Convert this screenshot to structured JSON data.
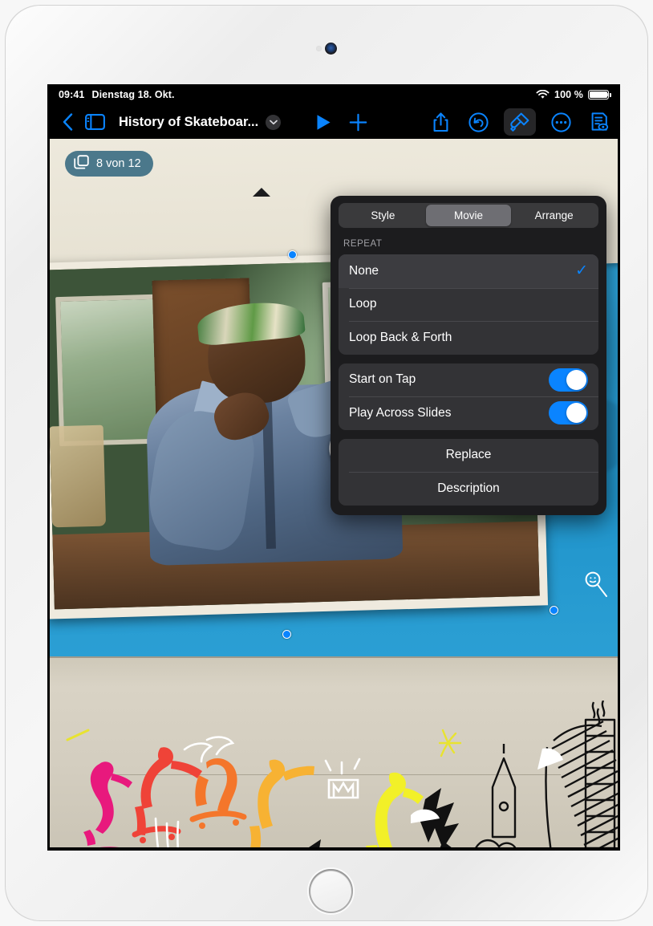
{
  "status_bar": {
    "time": "09:41",
    "date": "Dienstag 18. Okt.",
    "battery_text": "100 %",
    "wifi_icon": "wifi-icon",
    "battery_icon": "battery-full-icon",
    "more_dots_icon": "status-ellipsis-icon"
  },
  "toolbar": {
    "back_icon": "chevron-left-icon",
    "sidebar_icon": "sidebar-toggle-icon",
    "document_title": "History of Skateboar...",
    "title_chevron_icon": "chevron-down-icon",
    "play_icon": "play-icon",
    "add_icon": "plus-icon",
    "share_icon": "share-icon",
    "undo_icon": "undo-icon",
    "format_icon": "paintbrush-icon",
    "more_icon": "ellipsis-circle-icon",
    "notes_icon": "document-eye-icon"
  },
  "canvas": {
    "slide_badge": {
      "icon": "slides-stack-icon",
      "label": "8 von 12"
    },
    "video": {
      "play_overlay_icon": "play-circle-icon"
    },
    "selection_handles": 3
  },
  "popover": {
    "segments": [
      {
        "label": "Style",
        "selected": false
      },
      {
        "label": "Movie",
        "selected": true
      },
      {
        "label": "Arrange",
        "selected": false
      }
    ],
    "section_header": "REPEAT",
    "repeat_options": [
      {
        "label": "None",
        "checked": true
      },
      {
        "label": "Loop",
        "checked": false
      },
      {
        "label": "Loop Back & Forth",
        "checked": false
      }
    ],
    "toggles": [
      {
        "label": "Start on Tap",
        "on": true
      },
      {
        "label": "Play Across Slides",
        "on": true
      }
    ],
    "actions": [
      {
        "label": "Replace"
      },
      {
        "label": "Description"
      }
    ],
    "check_glyph": "✓"
  },
  "colors": {
    "accent_blue": "#0a84ff",
    "popover_bg": "#1c1c1e",
    "group_bg": "#333336",
    "segment_bg": "#3a3a3c",
    "segment_selected": "#6e6e73",
    "badge_bg": "rgba(30,88,116,.78)"
  }
}
